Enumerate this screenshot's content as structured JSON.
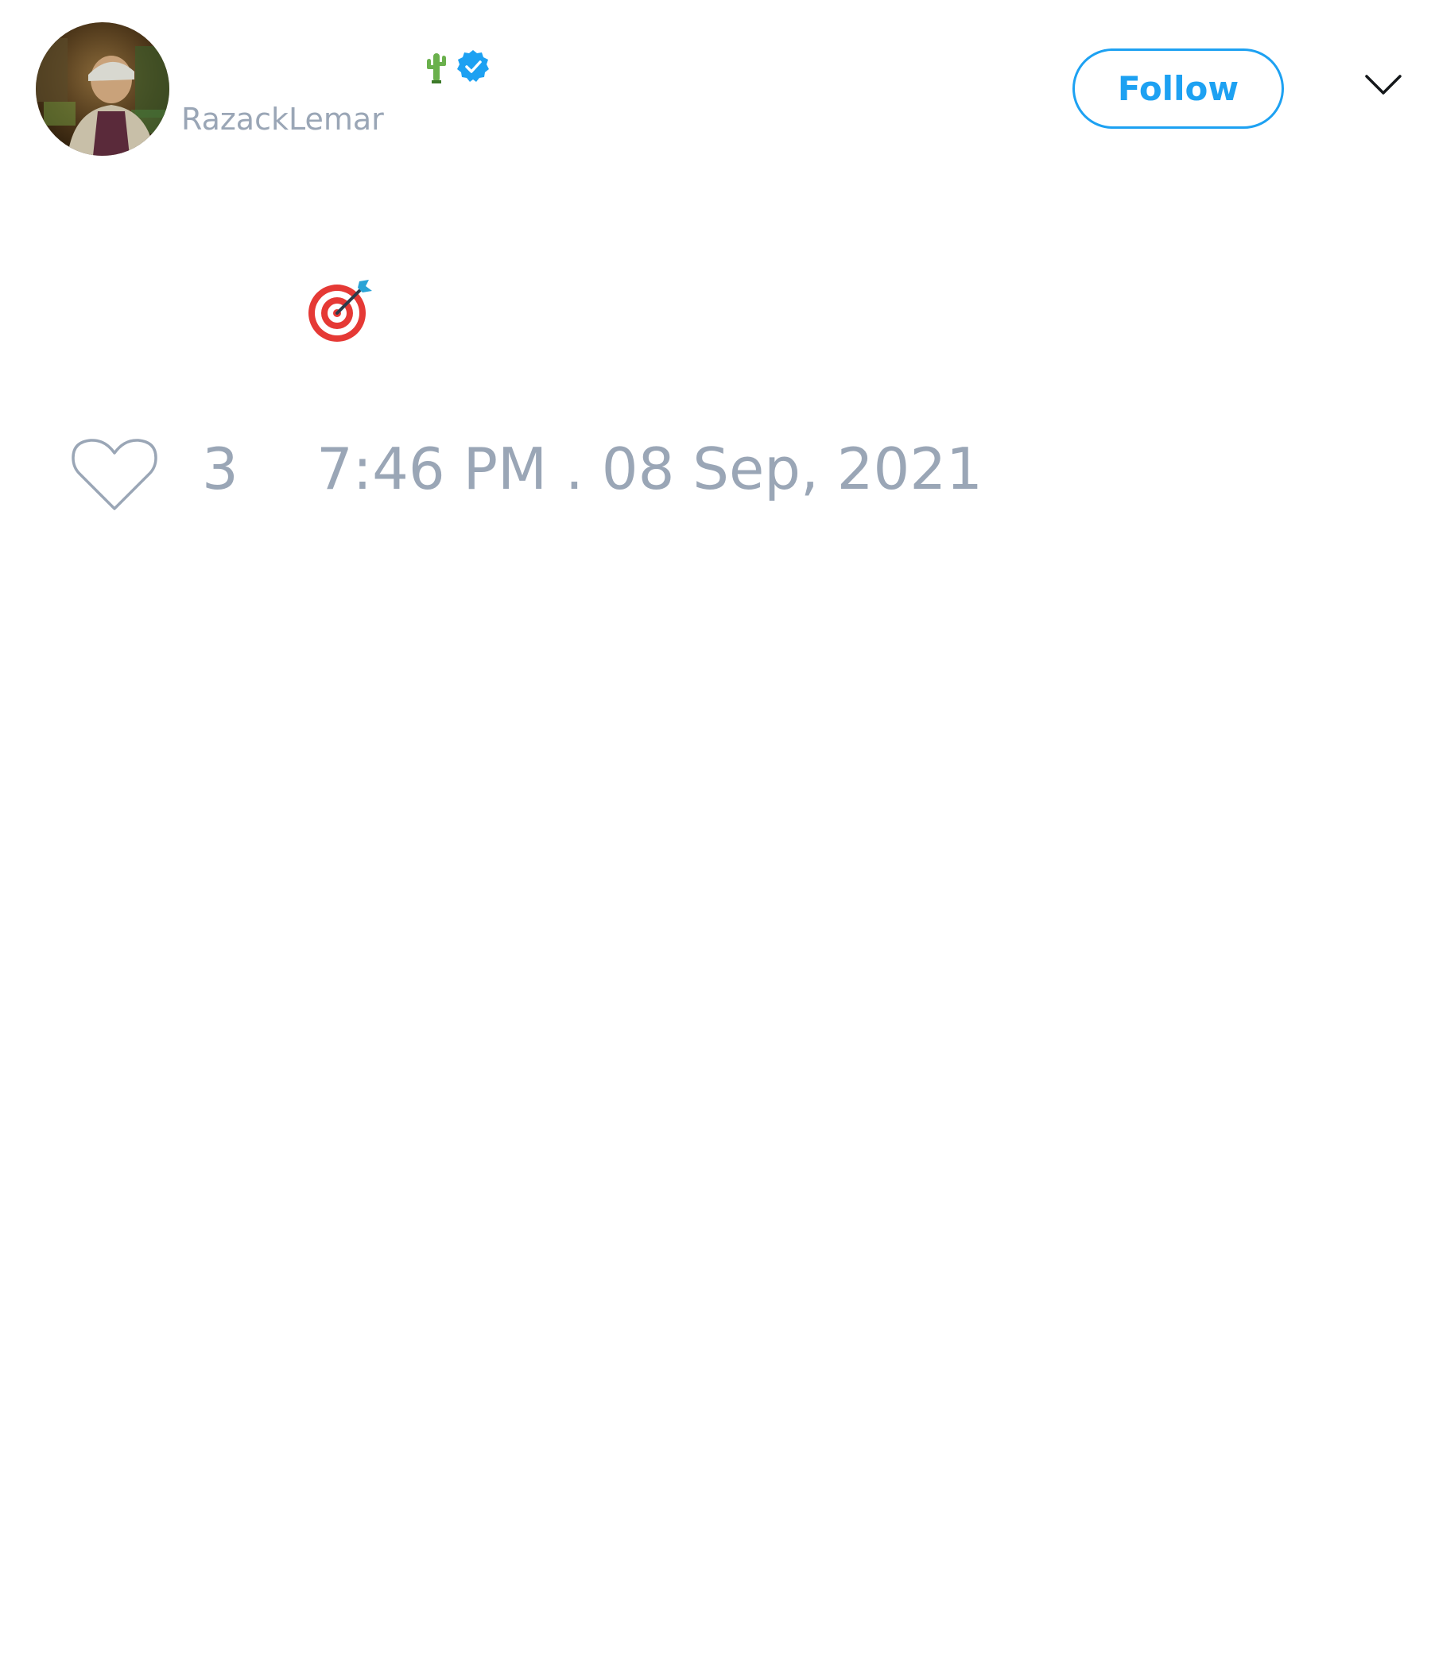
{
  "header": {
    "display_name": "",
    "username": "RazackLemar",
    "follow_label": "Follow",
    "icons": {
      "avatar": "user-avatar",
      "name_emoji": "cactus-emoji",
      "badge": "verified-badge-icon",
      "menu": "chevron-down-icon"
    }
  },
  "tweet": {
    "text": "",
    "emoji": "direct-hit-emoji"
  },
  "footer": {
    "like_icon": "heart-icon",
    "like_count": "3",
    "timestamp": "7:46 PM . 08 Sep, 2021"
  },
  "colors": {
    "accent": "#1da1f2",
    "muted_text": "#9aa6b6"
  }
}
